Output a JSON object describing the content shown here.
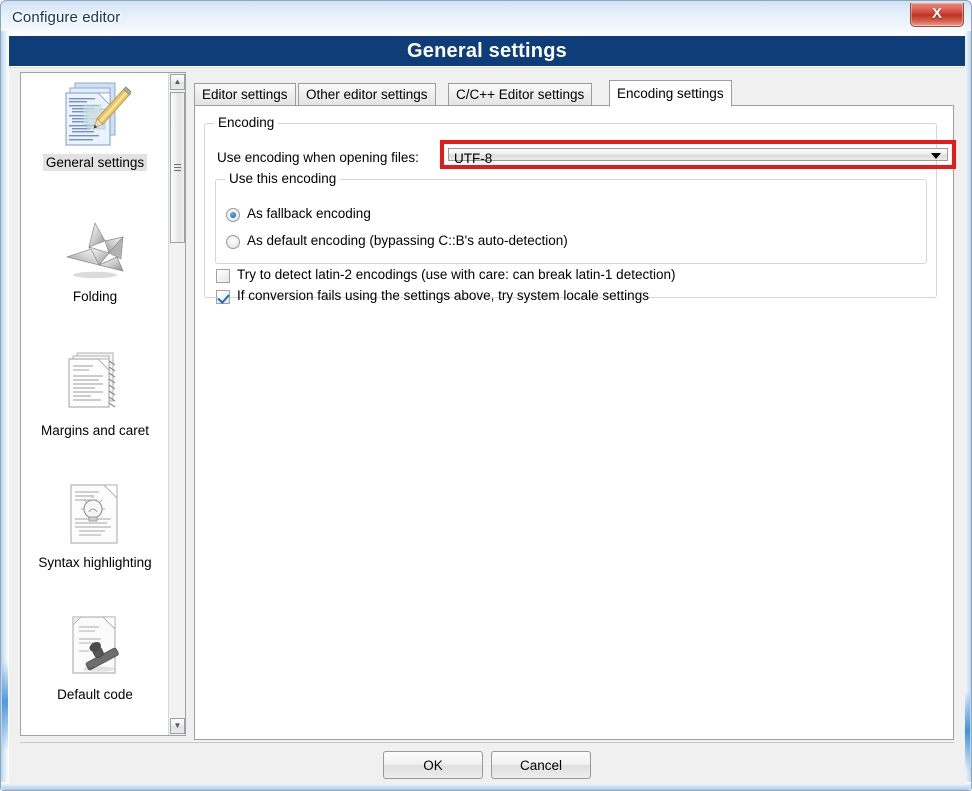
{
  "window": {
    "title": "Configure editor",
    "close_glyph": "X",
    "close_label": "Close"
  },
  "header": {
    "title": "General settings"
  },
  "sidebar": {
    "items": [
      {
        "label": "General settings",
        "icon": "documents-with-pencil-icon",
        "selected": true
      },
      {
        "label": "Folding",
        "icon": "origami-bird-icon",
        "selected": false
      },
      {
        "label": "Margins and caret",
        "icon": "lined-pages-icon",
        "selected": false
      },
      {
        "label": "Syntax highlighting",
        "icon": "page-with-lightbulb-icon",
        "selected": false
      },
      {
        "label": "Default code",
        "icon": "page-with-stamp-icon",
        "selected": false
      }
    ],
    "scrollbar": {
      "up_glyph": "▲",
      "down_glyph": "▼"
    }
  },
  "tabs": [
    {
      "label": "Editor settings",
      "active": false
    },
    {
      "label": "Other editor settings",
      "active": false
    },
    {
      "label": "C/C++ Editor settings",
      "active": false
    },
    {
      "label": "Encoding settings",
      "active": true
    }
  ],
  "encoding_panel": {
    "group_title": "Encoding",
    "combo_label": "Use encoding when opening files:",
    "combo_value": "UTF-8",
    "combo_arrow": "▼",
    "use_this_encoding": {
      "group_title": "Use this encoding",
      "options": [
        {
          "label": "As fallback encoding",
          "checked": true
        },
        {
          "label": "As default encoding (bypassing C::B's auto-detection)",
          "checked": false
        }
      ]
    },
    "checkboxes": [
      {
        "label": "Try to detect latin-2 encodings (use with care: can break latin-1 detection)",
        "checked": false
      },
      {
        "label": "If conversion fails using the settings above, try system locale settings",
        "checked": true
      }
    ]
  },
  "footer": {
    "ok_label": "OK",
    "cancel_label": "Cancel"
  },
  "colors": {
    "header_blue": "#0e3d79",
    "highlight_red": "#e81919",
    "close_red": "#c8402f",
    "accent_blue": "#1b75bb"
  }
}
